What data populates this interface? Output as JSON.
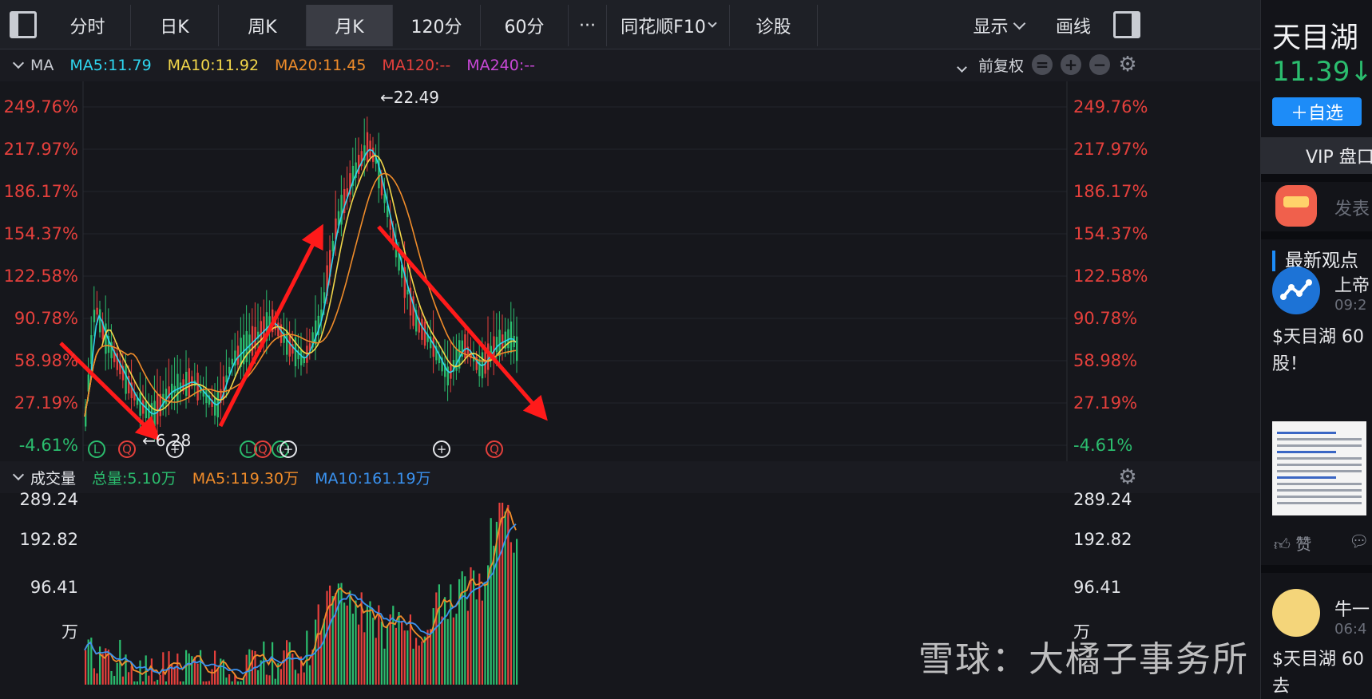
{
  "toolbar": {
    "tabs": [
      {
        "label": "分时"
      },
      {
        "label": "日K"
      },
      {
        "label": "周K"
      },
      {
        "label": "月K"
      },
      {
        "label": "120分"
      },
      {
        "label": "60分"
      },
      {
        "label": "···"
      },
      {
        "label": "同花顺F10"
      },
      {
        "label": "诊股"
      }
    ],
    "active_tab": "月K",
    "display_label": "显示",
    "draw_label": "画线"
  },
  "price_legend": {
    "name": "MA",
    "ma5": "MA5:11.79",
    "ma10": "MA10:11.92",
    "ma20": "MA20:11.45",
    "ma120": "MA120:--",
    "ma240": "MA240:--",
    "adjust_label": "前复权",
    "colors": {
      "ma5": "#2fd6f0",
      "ma10": "#f2d64a",
      "ma20": "#f08c2a",
      "ma120": "#e5403c",
      "ma240": "#c847d6"
    }
  },
  "volume_legend": {
    "name": "成交量",
    "total": "总量:5.10万",
    "ma5": "MA5:119.30万",
    "ma10": "MA10:161.19万"
  },
  "price_axis": [
    "249.76%",
    "217.97%",
    "186.17%",
    "154.37%",
    "122.58%",
    "90.78%",
    "58.98%",
    "27.19%",
    "-4.61%"
  ],
  "volume_axis": [
    "289.24",
    "192.82",
    "96.41",
    "万"
  ],
  "annotations": {
    "high": "←22.49",
    "low": "←6.28"
  },
  "event_markers": [
    {
      "label": "L"
    },
    {
      "label": "Q"
    },
    {
      "label": "+"
    },
    {
      "label": "L"
    },
    {
      "label": "Q"
    },
    {
      "label": "C"
    },
    {
      "label": "+"
    },
    {
      "label": "+"
    },
    {
      "label": "Q"
    }
  ],
  "sidebar": {
    "stock_name": "天目湖",
    "price": "11.39↓ -",
    "add_watch": "＋自选",
    "vip": "VIP 盘口",
    "post_prompt": "发表",
    "section_title": "最新观点",
    "posts": [
      {
        "author": "上帝",
        "time": "09:2",
        "text": "$天目湖 60",
        "text2": "股！"
      },
      {
        "author": "牛一",
        "time": "06:4",
        "text": "$天目湖 60",
        "text2": "去"
      }
    ],
    "like_label": "赞"
  },
  "watermark": "雪球：大橘子事务所",
  "chart_data": {
    "type": "candlestick",
    "title": "",
    "price_range": [
      -4.61,
      249.76
    ],
    "volume_range": [
      0,
      289.24
    ],
    "price_high_label": 22.49,
    "price_low_label": 6.28,
    "trend_arrows": [
      "down",
      "up",
      "down"
    ]
  }
}
